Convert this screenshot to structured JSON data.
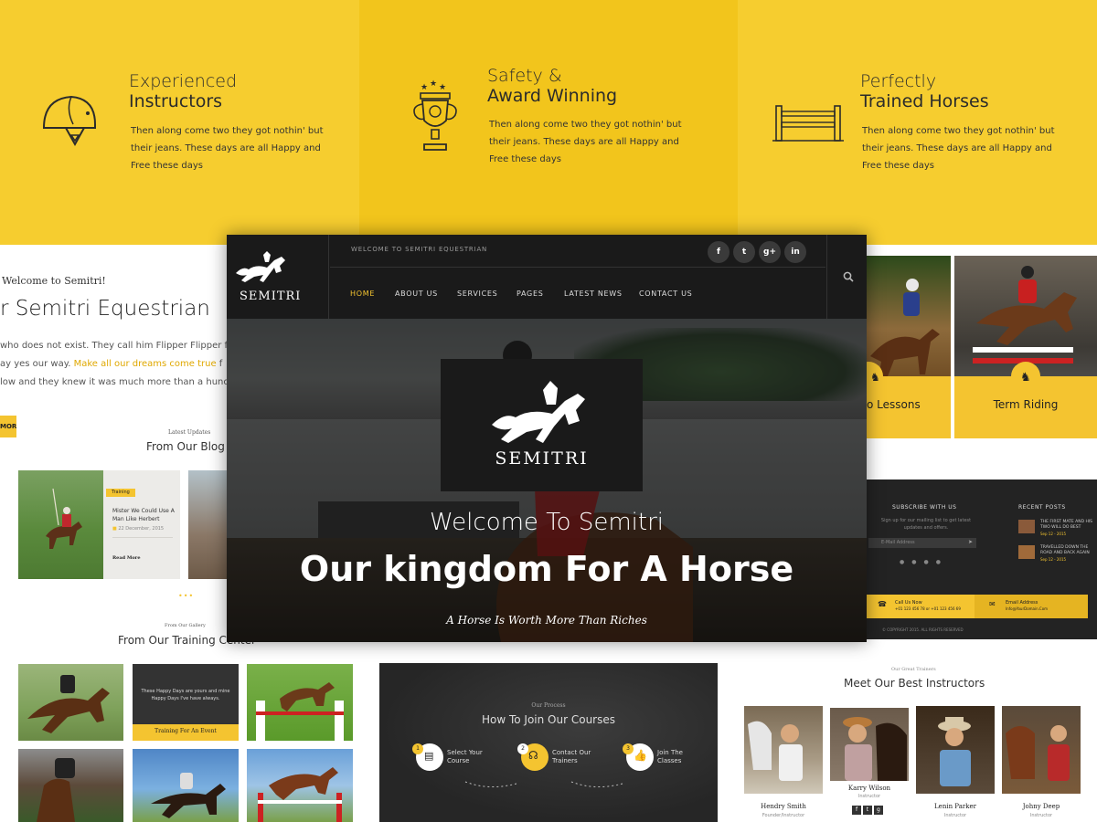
{
  "features": [
    {
      "line1": "Experienced",
      "line2": "Instructors",
      "text": "Then along come two they got nothin' but their jeans. These days are all Happy and Free these days",
      "icon": "helmet-icon",
      "bg": "#f6cd2f"
    },
    {
      "line1": "Safety &",
      "line2": "Award Winning",
      "text": "Then along come two they got nothin' but their jeans. These days are all Happy and Free these days",
      "icon": "trophy-icon",
      "bg": "#f2c51c"
    },
    {
      "line1": "Perfectly",
      "line2": "Trained Horses",
      "text": "Then along come two they got nothin' but their jeans. These days are all Happy and Free these days",
      "icon": "fence-icon",
      "bg": "#f6cd2f"
    }
  ],
  "about": {
    "kicker": "Welcome to Semitri!",
    "title": "r Semitri Equestrian",
    "line1": "who does not exist. They call him Flipper Flipper f",
    "line2a": "ay yes our way.",
    "line2_link": "Make all our dreams come true",
    "line2b": "f",
    "line3": "low and they knew it was much more than a hunc",
    "more_button": "MOR"
  },
  "blog": {
    "kicker": "Latest Updates",
    "title": "From Our Blog",
    "post": {
      "tag": "Training",
      "title": "Mister We Could Use A Man Like Herbert",
      "date": "22 December, 2015",
      "read_more": "Read More"
    }
  },
  "gallery": {
    "kicker": "From Our Gallery",
    "title": "From Our Training Center",
    "quote": "These Happy Days are yours and mine Happy Days I've have always.",
    "caption": "Training For An Event"
  },
  "hero": {
    "topbar": "WELCOME TO SEMITRI EQUESTRIAN",
    "brand": "SEMITRI",
    "nav": [
      "HOME",
      "ABOUT US",
      "SERVICES",
      "PAGES",
      "LATEST NEWS",
      "CONTACT US"
    ],
    "social": [
      "f",
      "t",
      "g+",
      "in"
    ],
    "welcome": "Welcome To Semitri",
    "headline": "Our kingdom For A Horse",
    "tagline": "A Horse Is Worth More Than Riches",
    "accent": "#f4c430"
  },
  "services": {
    "left_label": "o Lessons",
    "right_label": "Term Riding"
  },
  "footer": {
    "subscribe_title": "SUBSCRIBE WITH US",
    "subscribe_text": "Sign up for our mailing list to get latest updates and offers.",
    "email_placeholder": "E-Mail Address",
    "recent_title": "RECENT POSTS",
    "posts": [
      {
        "title": "THE FIRST MATE AND HIS TWO WILL DO BEST",
        "date": "Sep 12 - 2015"
      },
      {
        "title": "TRAVELLED DOWN THE ROAD AND BACK AGAIN",
        "date": "Sep 12 - 2015"
      }
    ],
    "call_label": "Call Us Now",
    "phone": "+01 123 456 78 or +01 123 456 69",
    "email_label": "Email Address",
    "email": "Info@YourDomain.Com",
    "copyright": "© COPYRIGHT 2015. ALL RIGHTS RESERVED"
  },
  "process": {
    "kicker": "Our Process",
    "title": "How To Join Our Courses",
    "steps": [
      {
        "num": "1",
        "line1": "Select Your",
        "line2": "Course"
      },
      {
        "num": "2",
        "line1": "Contact Our",
        "line2": "Trainers"
      },
      {
        "num": "3",
        "line1": "Join The",
        "line2": "Classes"
      }
    ]
  },
  "trainers": {
    "kicker": "Our Great Trainers",
    "title": "Meet Our Best Instructors",
    "people": [
      {
        "name": "Hendry Smith",
        "role": "Founder/Instructor"
      },
      {
        "name": "Karry Wilson",
        "role": "Instructor"
      },
      {
        "name": "Lenin Parker",
        "role": "Instructor"
      },
      {
        "name": "Johny Deep",
        "role": "Instructor"
      }
    ]
  }
}
